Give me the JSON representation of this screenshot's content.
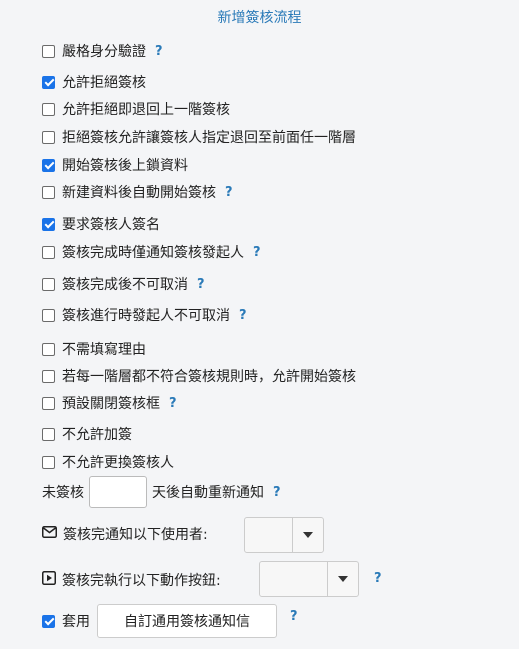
{
  "title": "新增簽核流程",
  "options": [
    {
      "label": "嚴格身分驗證",
      "checked": false,
      "help": true
    },
    {
      "label": "允許拒絕簽核",
      "checked": true,
      "help": false
    },
    {
      "label": "允許拒絕即退回上一階簽核",
      "checked": false,
      "help": false
    },
    {
      "label": "拒絕簽核允許讓簽核人指定退回至前面任一階層",
      "checked": false,
      "help": false
    },
    {
      "label": "開始簽核後上鎖資料",
      "checked": true,
      "help": false
    },
    {
      "label": "新建資料後自動開始簽核",
      "checked": false,
      "help": true
    },
    {
      "label": "要求簽核人簽名",
      "checked": true,
      "help": false
    },
    {
      "label": "簽核完成時僅通知簽核發起人",
      "checked": false,
      "help": true
    },
    {
      "label": "簽核完成後不可取消",
      "checked": false,
      "help": true
    },
    {
      "label": "簽核進行時發起人不可取消",
      "checked": false,
      "help": true
    },
    {
      "label": "不需填寫理由",
      "checked": false,
      "help": false
    },
    {
      "label": "若每一階層都不符合簽核規則時，允許開始簽核",
      "checked": false,
      "help": false
    },
    {
      "label": "預設關閉簽核框",
      "checked": false,
      "help": true
    },
    {
      "label": "不允許加簽",
      "checked": false,
      "help": false
    },
    {
      "label": "不允許更換簽核人",
      "checked": false,
      "help": false
    }
  ],
  "help_mark": "?",
  "renotify": {
    "prefix": "未簽核",
    "suffix": "天後自動重新通知",
    "value": ""
  },
  "notify_users": {
    "label": "簽核完通知以下使用者:",
    "selected": "",
    "icon": "envelope-icon"
  },
  "action_button": {
    "label": "簽核完執行以下動作按鈕:",
    "selected": "",
    "icon": "play-square-icon"
  },
  "apply": {
    "label": "套用",
    "checked": true,
    "button_label": "自訂通用簽核通知信"
  }
}
